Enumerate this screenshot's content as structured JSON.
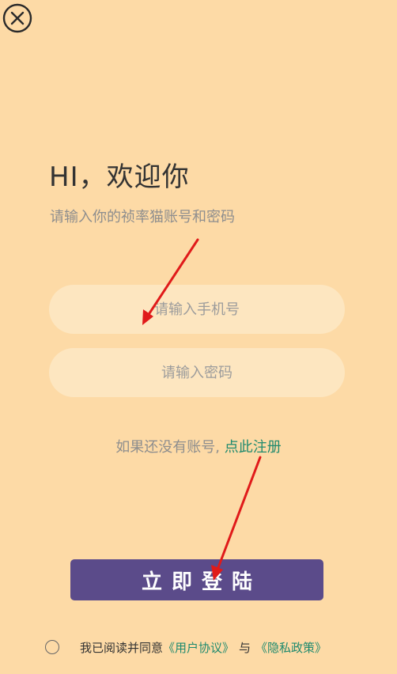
{
  "header": {
    "title": "HI，欢迎你",
    "subtitle": "请输入你的祯率猫账号和密码"
  },
  "form": {
    "phone_placeholder": "请输入手机号",
    "password_placeholder": "请输入密码"
  },
  "register": {
    "prompt": "如果还没有账号, ",
    "link": "点此注册"
  },
  "login_button": "立即登陆",
  "agreement": {
    "prefix": "我已阅读并同意",
    "user_agreement": "《用户协议》",
    "conjunction": "与",
    "privacy_policy": "《隐私政策》"
  },
  "colors": {
    "background": "#fddaa6",
    "input_bg": "#fde6c0",
    "button": "#5b4b8a",
    "link": "#1f8a6e",
    "annotation_arrow": "#e01a1a"
  },
  "icons": {
    "close": "close-circle-icon"
  }
}
